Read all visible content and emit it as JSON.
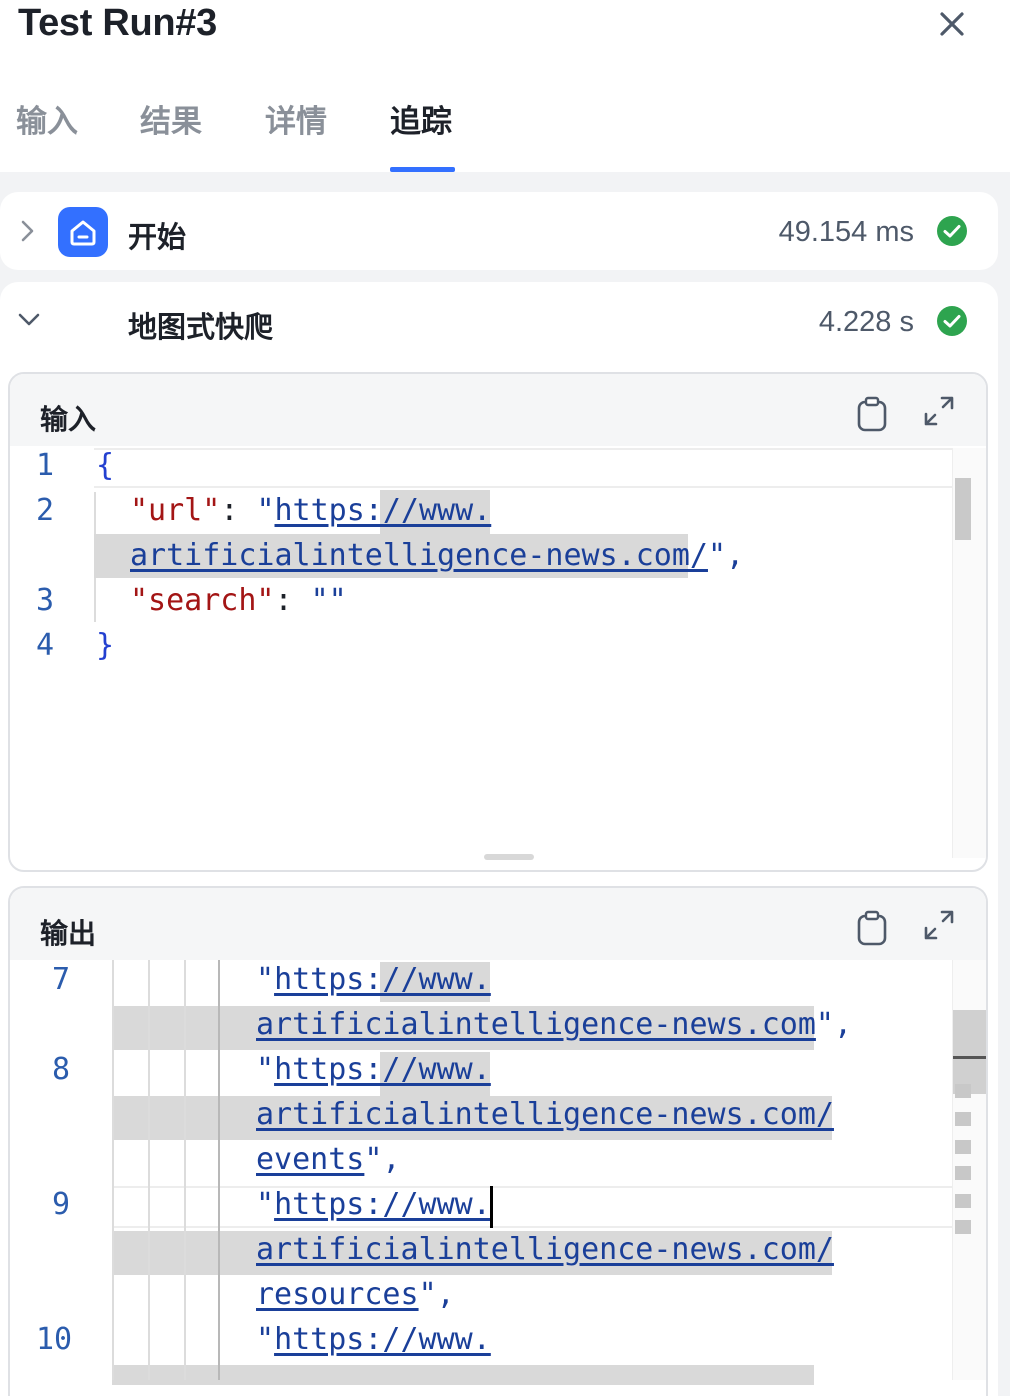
{
  "window": {
    "title": "Test Run#3"
  },
  "tabs": [
    {
      "label": "输入"
    },
    {
      "label": "结果"
    },
    {
      "label": "详情"
    },
    {
      "label": "追踪"
    }
  ],
  "active_tab": "追踪",
  "nodes": [
    {
      "name": "开始",
      "time": "49.154 ms",
      "status": "success",
      "expanded": false
    },
    {
      "name": "地图式快爬",
      "time": "4.228 s",
      "status": "success",
      "expanded": true
    }
  ],
  "input_panel": {
    "title": "输入",
    "line_numbers": [
      "1",
      "2",
      "3",
      "4"
    ],
    "code": {
      "open_brace": "{",
      "url_key": "\"url\"",
      "colon1": ": ",
      "url_quote_open": "\"",
      "url_part1": "https://www.",
      "url_part2": "artificialintelligence-news.com/",
      "url_tail": "\",",
      "search_key": "\"search\"",
      "colon2": ": ",
      "search_value": "\"\"",
      "close_brace": "}"
    }
  },
  "output_panel": {
    "title": "输出",
    "line_numbers": [
      "7",
      "8",
      "9",
      "10"
    ],
    "entries": [
      {
        "q": "\"",
        "part1": "https://www.",
        "part2": "artificialintelligence-news.com",
        "part3": "",
        "tail": "\","
      },
      {
        "q": "\"",
        "part1": "https://www.",
        "part2": "artificialintelligence-news.com/",
        "part3": "events",
        "tail": "\","
      },
      {
        "q": "\"",
        "part1": "https://www.",
        "part2": "artificialintelligence-news.com/",
        "part3": "resources",
        "tail": "\","
      },
      {
        "q": "\"",
        "part1": "https://www."
      }
    ]
  },
  "colors": {
    "accent": "#3370ff",
    "success": "#2ea44f",
    "json_key": "#a31515",
    "json_string": "#1a3f99"
  },
  "icons": [
    "close-icon",
    "chevron-right-icon",
    "home-icon",
    "check-circle-icon",
    "chevron-down-icon",
    "copy-icon",
    "expand-icon"
  ]
}
